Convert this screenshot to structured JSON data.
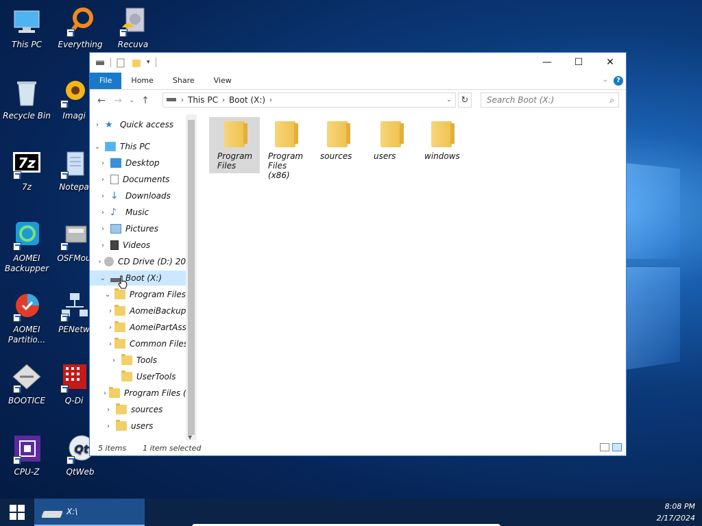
{
  "desktop": {
    "icons": [
      {
        "label": "This PC",
        "icon": "computer-icon"
      },
      {
        "label": "Everything",
        "icon": "everything-search-icon"
      },
      {
        "label": "Recuva",
        "icon": "recuva-icon"
      },
      {
        "label": "Recycle Bin",
        "icon": "recycle-bin-icon"
      },
      {
        "label": "Imagi",
        "icon": "imagine-icon"
      },
      {
        "label": "7z",
        "icon": "7zip-icon"
      },
      {
        "label": "Notepa",
        "icon": "notepad-icon"
      },
      {
        "label": "AOMEI Backupper",
        "icon": "aomei-backupper-icon"
      },
      {
        "label": "OSFMou",
        "icon": "osfmount-icon"
      },
      {
        "label": "AOMEI Partitio...",
        "icon": "aomei-partition-icon"
      },
      {
        "label": "PENetw",
        "icon": "penetwork-icon"
      },
      {
        "label": "BOOTICE",
        "icon": "bootice-icon"
      },
      {
        "label": "Q-Di",
        "icon": "q-dir-icon"
      },
      {
        "label": "CPU-Z",
        "icon": "cpu-z-icon"
      },
      {
        "label": "QtWeb",
        "icon": "qtweb-icon"
      }
    ]
  },
  "window": {
    "ribbon_tabs": [
      "File",
      "Home",
      "Share",
      "View"
    ],
    "help_label": "?",
    "address": {
      "crumbs": [
        "This PC",
        "Boot (X:)"
      ]
    },
    "search_placeholder": "Search Boot (X:)",
    "nav_tree": [
      {
        "label": "Quick access",
        "expander": "›",
        "icon": "star-icon"
      },
      {
        "label": "This PC",
        "expander": "⌄",
        "icon": "computer-icon"
      },
      {
        "label": "Desktop",
        "expander": "›",
        "icon": "desktop-icon"
      },
      {
        "label": "Documents",
        "expander": "›",
        "icon": "documents-icon"
      },
      {
        "label": "Downloads",
        "expander": "›",
        "icon": "downloads-icon"
      },
      {
        "label": "Music",
        "expander": "›",
        "icon": "music-icon"
      },
      {
        "label": "Pictures",
        "expander": "›",
        "icon": "pictures-icon"
      },
      {
        "label": "Videos",
        "expander": "›",
        "icon": "videos-icon"
      },
      {
        "label": "CD Drive (D:) 20",
        "expander": "›",
        "icon": "cd-drive-icon"
      },
      {
        "label": "Boot (X:)",
        "expander": "⌄",
        "icon": "drive-icon",
        "selected": true
      },
      {
        "label": "Program Files",
        "expander": "⌄",
        "icon": "folder-icon"
      },
      {
        "label": "AomeiBackup",
        "expander": "›",
        "icon": "folder-icon"
      },
      {
        "label": "AomeiPartAss",
        "expander": "›",
        "icon": "folder-icon"
      },
      {
        "label": "Common Files",
        "expander": "›",
        "icon": "folder-icon"
      },
      {
        "label": "Tools",
        "expander": "›",
        "icon": "folder-icon"
      },
      {
        "label": "UserTools",
        "expander": "",
        "icon": "folder-icon"
      },
      {
        "label": "Program Files (",
        "expander": "›",
        "icon": "folder-icon"
      },
      {
        "label": "sources",
        "expander": "›",
        "icon": "folder-icon"
      },
      {
        "label": "users",
        "expander": "›",
        "icon": "folder-icon"
      }
    ],
    "items": [
      {
        "label": "Program Files",
        "selected": true
      },
      {
        "label": "Program Files (x86)"
      },
      {
        "label": "sources"
      },
      {
        "label": "users"
      },
      {
        "label": "windows"
      }
    ],
    "status": {
      "count": "5 items",
      "selection": "1 item selected"
    },
    "accent": "#1979ca"
  },
  "taskbar": {
    "item_label": "X:\\",
    "time": "8:08 PM",
    "date": "2/17/2024"
  }
}
